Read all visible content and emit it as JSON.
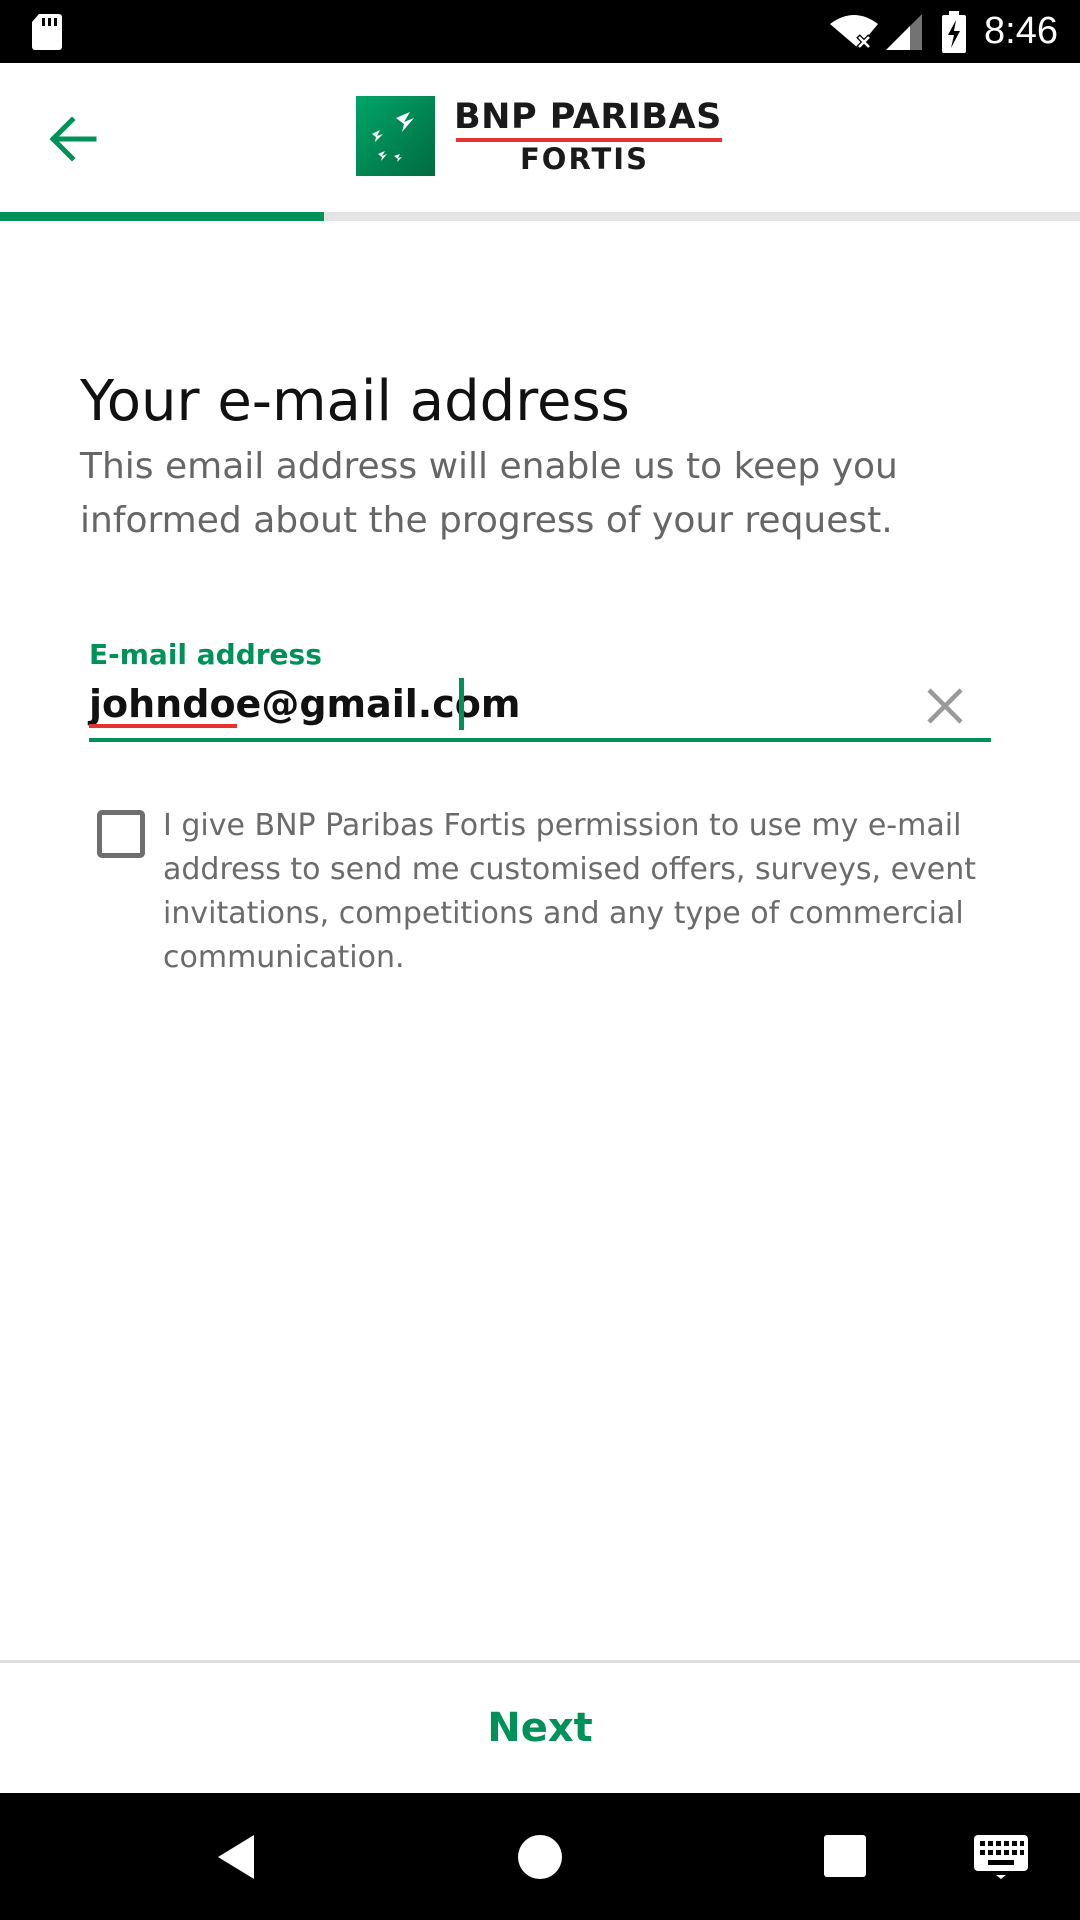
{
  "status_bar": {
    "time": "8:46",
    "icons": [
      "sd-card-icon",
      "wifi-icon",
      "signal-icon",
      "battery-charging-icon"
    ]
  },
  "app_bar": {
    "back_icon": "arrow-left-icon",
    "logo": {
      "line1": "BNP PARIBAS",
      "line2": "FORTIS",
      "brand_color": "#00915a",
      "underline_color": "#e3342f"
    }
  },
  "progress": {
    "fraction": 0.3,
    "color": "#00915a"
  },
  "form": {
    "title": "Your e-mail address",
    "description": "This email address will enable us to keep you informed about the progress of your request.",
    "email": {
      "label": "E-mail address",
      "value": "johndoe@gmail.com",
      "clear_icon": "close-icon"
    },
    "consent": {
      "checked": false,
      "text": "I give BNP Paribas Fortis permission to use my e-mail address to send me customised offers, surveys, event invitations, competitions and any type of commercial communication."
    }
  },
  "footer": {
    "next_label": "Next"
  },
  "nav_bar": {
    "icons": [
      "back-triangle-icon",
      "home-circle-icon",
      "recents-square-icon",
      "keyboard-icon"
    ]
  },
  "colors": {
    "accent": "#00915a",
    "error_underline": "#e3342f",
    "text_primary": "#111111",
    "text_secondary": "#666666"
  }
}
